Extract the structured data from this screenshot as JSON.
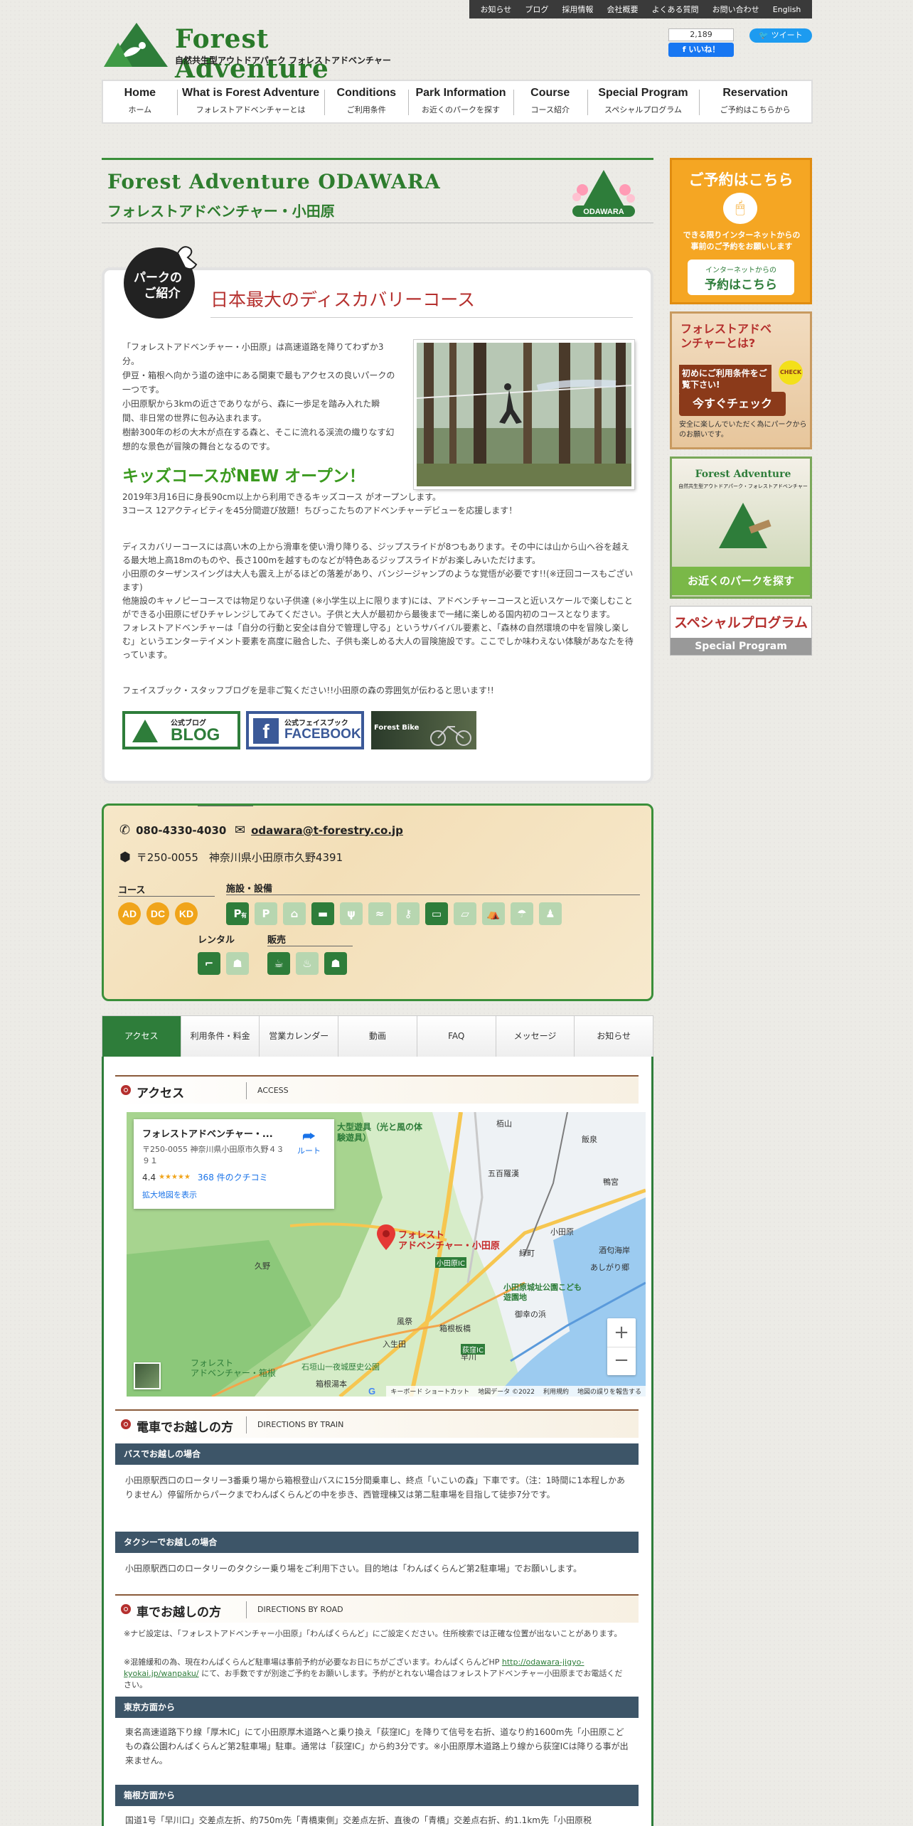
{
  "util_bar": [
    "お知らせ",
    "ブログ",
    "採用情報",
    "会社概要",
    "よくある質問",
    "お問い合わせ",
    "English"
  ],
  "logo": {
    "title": "Forest Adventure",
    "subtitle": "自然共生型アウトドアパーク フォレストアドベンチャー"
  },
  "social": {
    "fb_count": "2,189",
    "fb_like": "いいね！",
    "tweet": "ツイート"
  },
  "nav": [
    {
      "en": "Home",
      "jp": "ホーム"
    },
    {
      "en": "What is Forest Adventure",
      "jp": "フォレストアドベンチャーとは"
    },
    {
      "en": "Conditions",
      "jp": "ご利用条件"
    },
    {
      "en": "Park Information",
      "jp": "お近くのパークを探す"
    },
    {
      "en": "Course",
      "jp": "コース紹介"
    },
    {
      "en": "Special Program",
      "jp": "スペシャルプログラム"
    },
    {
      "en": "Reservation",
      "jp": "ご予約はこちらから"
    }
  ],
  "park": {
    "title_en": "Forest Adventure ODAWARA",
    "title_jp": "フォレストアドベンチャー・小田原",
    "badge": "ODAWARA"
  },
  "intro": {
    "badge_line1": "パークの",
    "badge_line2": "ご紹介",
    "heading": "日本最大のディスカバリーコース",
    "paragraph": [
      "「フォレストアドベンチャー・小田原」は高速道路を降りてわずか3分。",
      "伊豆・箱根へ向かう道の途中にある関東で最もアクセスの良いパークの一つです。",
      "小田原駅から3kmの近さでありながら、森に一歩足を踏み入れた瞬間、非日常の世界に包み込まれます。",
      "樹齢300年の杉の大木が点在する森と、そこに流れる渓流の織りなす幻想的な景色が冒険の舞台となるのです。"
    ],
    "kids_heading": "キッズコースがNEW オープン！",
    "kids_text": [
      "2019年3月16日に身長90cm以上から利用できるキッズコース がオープンします。",
      "3コース 12アクティビティを45分間遊び放題！ちびっこたちのアドベンチャーデビューを応援します！"
    ],
    "disc_text": [
      "ディスカバリーコースには高い木の上から滑車を使い滑り降りる、ジップスライドが8つもあります。その中には山から山へ谷を越える最大地上高18mのものや、長さ100mを越すものなどが特色あるジップスライドがお楽しみいただけます。",
      "小田原のターザンスイングは大人も震え上がるほどの落差があり、バンジージャンプのような覚悟が必要です!!(※迂回コースもございます)",
      "他施設のキャノピーコースでは物足りない子供達 (※小学生以上に限ります)には、アドベンチャーコースと近いスケールで楽しむことができる小田原にぜひチャレンジしてみてください。子供と大人が最初から最後まで一緒に楽しめる国内初のコースとなります。",
      "フォレストアドベンチャーは「自分の行動と安全は自分で管理し守る」というサバイバル要素と、「森林の自然環境の中を冒険し楽しむ」というエンターテイメント要素を高度に融合した、子供も楽しめる大人の冒険施設です。ここでしか味わえない体験があなたを待っています。"
    ],
    "blog_text": "フェイスブック・スタッフブログを是非ご覧ください!!小田原の森の雰囲気が伝わると思います!!",
    "buttons": {
      "blog_small": "公式ブログ",
      "blog": "BLOG",
      "fb_small": "公式フェイスブック",
      "fb": "FACEBOOK",
      "bike": "Forest Bike"
    }
  },
  "info": {
    "phone": "080-4330-4030",
    "email": "odawara@t-forestry.co.jp",
    "address": "〒250-0055　神奈川県小田原市久野4391",
    "course_label": "コース",
    "facility_label": "施設・設備",
    "rental_label": "レンタル",
    "sales_label": "販売",
    "courses": [
      "AD",
      "DC",
      "KD"
    ],
    "facility_glyphs": [
      "P",
      "P",
      "⌂",
      "▬",
      "ψ",
      "≈",
      "⚷",
      "▭",
      "▱",
      "⛺",
      "☂",
      "♟"
    ],
    "facility_on": [
      true,
      false,
      false,
      true,
      false,
      false,
      false,
      true,
      false,
      false,
      false,
      false
    ],
    "parking_note": "有",
    "rental_glyphs": [
      "⌐",
      "☗"
    ],
    "sales_glyphs": [
      "☕",
      "♨",
      "☗"
    ]
  },
  "tabs": [
    "アクセス",
    "利用条件・料金",
    "営業カレンダー",
    "動画",
    "FAQ",
    "メッセージ",
    "お知らせ"
  ],
  "access": {
    "heading_jp": "アクセス",
    "heading_en": "ACCESS",
    "map": {
      "place_name": "フォレストアドベンチャー・...",
      "place_address": "〒250-0055 神奈川県小田原市久野４３９１",
      "rating": "4.4",
      "stars": "★★★★★",
      "reviews": "368 件のクチコミ",
      "enlarge": "拡大地図を表示",
      "route": "ルート",
      "pin_label": "フォレスト\nアドベンチャー・小田原",
      "labels": [
        "大型遊具（光と風の体験遊具）",
        "久野",
        "小田原城址公園こども遊園地",
        "箱根板橋",
        "早川",
        "石垣山一夜城歴史公園",
        "フォレスト\nアドベンチャー・箱根",
        "あしがり郷",
        "小田原IC",
        "荻窪IC",
        "酒匂海岸",
        "小田原",
        "五百羅漢",
        "緑町",
        "風祭",
        "入生田",
        "箱根湯本",
        "飯泉",
        "鴨宮",
        "栢山",
        "御幸の浜"
      ],
      "attribution": [
        "キーボード ショートカット",
        "地図データ ©2022",
        "利用規約",
        "地図の誤りを報告する"
      ]
    }
  },
  "train": {
    "heading_jp": "電車でお越しの方",
    "heading_en": "DIRECTIONS BY TRAIN",
    "bus_title": "バスでお越しの場合",
    "bus_text": "小田原駅西口のロータリー3番乗り場から箱根登山バスに15分間乗車し、終点「いこいの森」下車です。（注：1時間に1本程しかありません）停留所からパークまでわんぱくらんどの中を歩き、西管理棟又は第二駐車場を目指して徒歩7分です。",
    "taxi_title": "タクシーでお越しの場合",
    "taxi_text": "小田原駅西口のロータリーのタクシー乗り場をご利用下さい。目的地は「わんぱくらんど第2駐車場」でお願いします。"
  },
  "car": {
    "heading_jp": "車でお越しの方",
    "heading_en": "DIRECTIONS BY ROAD",
    "note1": "※ナビ設定は、「フォレストアドベンチャー小田原」「わんぱくらんど」にご設定ください。住所検索では正確な位置が出ないことがあります。",
    "note2a": "※混雑緩和の為、現在わんぱくらんど駐車場は事前予約が必要なお日にちがございます。わんぱくらんどHP",
    "note2_link": "http://odawara-jigyo-kyokai.jp/wanpaku/",
    "note2b": "にて、お手数ですが別途ご予約をお願いします。予約がとれない場合はフォレストアドベンチャー小田原までお電話ください。",
    "tokyo_title": "東京方面から",
    "tokyo_text": "東名高速道路下り線「厚木IC」にて小田原厚木道路へと乗り換え「荻窪IC」を降りて信号を右折、道なり約1600m先「小田原こどもの森公園わんぱくらんど第2駐車場」駐車。通常は「荻窪IC」から約3分です。※小田原厚木道路上り線から荻窪ICは降りる事が出来ません。",
    "hakone_title": "箱根方面から",
    "hakone_text": "国道1号「早川口」交差点左折、約750m先「青橋東側」交差点左折、直後の「青橋」交差点右折、約1.1km先「小田原税"
  },
  "sidebar": {
    "reserve": {
      "title": "ご予約はこちら",
      "text": "できる限りインターネットからの事前のご予約をお願いします",
      "sub": "インターネットからの",
      "btn": "予約はこちら"
    },
    "about": {
      "title": "フォレストアドベンチャーとは?",
      "text": "初めにご利用条件をご覧下さい!",
      "check": "CHECK",
      "btn": "今すぐチェック",
      "note": "安全に楽しんでいただく為にパークからのお願いです。"
    },
    "find": {
      "logo": "Forest Adventure",
      "sub": "自然共生型アウトドアパーク・フォレストアドベンチャー",
      "btn": "お近くのパークを探す"
    },
    "special": {
      "title": "スペシャルプログラム",
      "sub": "Special Program"
    }
  },
  "colors": {
    "brand_green": "#2e7d3a",
    "heading_red": "#b5302e",
    "kids_green": "#3b9a1f",
    "orange": "#f0a41a",
    "sub_bar": "#3d5568"
  }
}
